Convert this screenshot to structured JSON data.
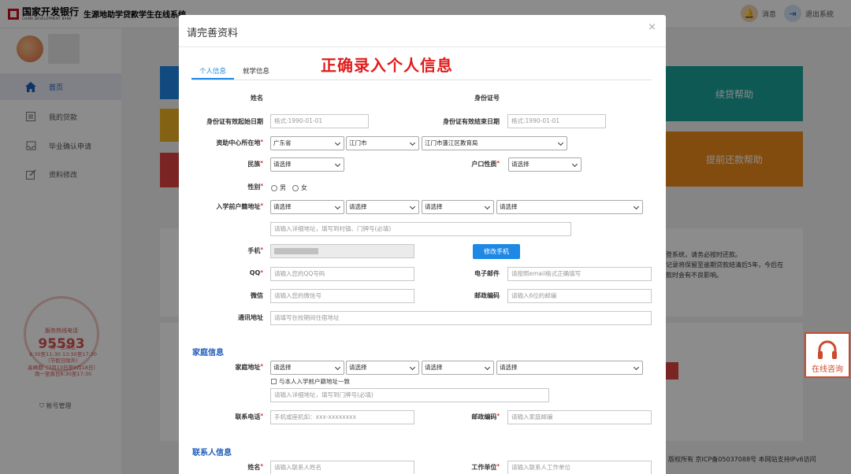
{
  "header": {
    "bank_name": "国家开发银行",
    "bank_name_en": "CHINA DEVELOPMENT BANK",
    "system_name": "生源地助学贷款学生在线系统",
    "messages_label": "消息",
    "logout_label": "退出系统"
  },
  "sidebar": {
    "items": [
      {
        "label": "首页",
        "icon": "home-icon",
        "active": true
      },
      {
        "label": "我的贷款",
        "icon": "list-icon"
      },
      {
        "label": "毕业确认申请",
        "icon": "inbox-icon"
      },
      {
        "label": "资料修改",
        "icon": "edit-icon"
      }
    ],
    "hotline": {
      "label": "服务热线电话",
      "number": "95593",
      "hours": [
        "周一至周五",
        "8:30至11:30 13:30至17:30",
        "（节假日除外）",
        "高峰期（7月13日至9月18日）",
        "周一至周日8:30至17:30"
      ]
    },
    "account_label": "帐号管理"
  },
  "background": {
    "tile_renew": "续贷帮助",
    "tile_prepay": "提前还款帮助",
    "notice_lines": [
      "登系统，请务必按时还款。",
      "记录将保留至逾期贷款结清后5年，今后在",
      "款时会有不良影响。"
    ],
    "footer": "版权所有 京ICP备05037088号 本网站支持IPv6访问",
    "consult_label": "在线咨询"
  },
  "modal": {
    "title": "请完善资料",
    "close": "×",
    "tabs": [
      "个人信息",
      "就学信息"
    ],
    "annotation": "正确录入个人信息",
    "fields": {
      "name_label": "姓名",
      "id_label": "身份证号",
      "id_start_label": "身份证有效起始日期",
      "id_start_placeholder": "格式:1990-01-01",
      "id_end_label": "身份证有效结束日期",
      "id_end_placeholder": "格式:1990-01-01",
      "center_label": "资助中心所在地",
      "center_province": "广东省",
      "center_city": "江门市",
      "center_bureau": "江门市蓬江区教育局",
      "ethnicity_label": "民族",
      "ethnicity_value": "请选择",
      "hukou_type_label": "户口性质",
      "hukou_type_value": "请选择",
      "gender_label": "性别",
      "gender_male": "男",
      "gender_female": "女",
      "hukou_addr_label": "入学前户籍地址",
      "select_placeholder": "请选择",
      "hukou_detail_placeholder": "请输入详细地址，填写到村镇、门牌号(必填)",
      "phone_label": "手机",
      "change_phone": "修改手机",
      "qq_label": "QQ",
      "qq_placeholder": "请输入您的QQ号码",
      "email_label": "电子邮件",
      "email_placeholder": "请按照email格式正确填写",
      "wechat_label": "微信",
      "wechat_placeholder": "请输入您的微信号",
      "postcode_label": "邮政编码",
      "postcode_placeholder": "请输入6位的邮编",
      "mail_addr_label": "通讯地址",
      "mail_addr_placeholder": "请填写在校期间住宿地址"
    },
    "family": {
      "section_title": "家庭信息",
      "addr_label": "家庭地址",
      "same_as_hukou": "与本人入学前户籍地址一致",
      "detail_placeholder": "请输入详细地址，填写到门牌号(必填)",
      "phone_label": "联系电话",
      "phone_placeholder": "手机或座机如：xxx-xxxxxxxx",
      "postcode_label": "邮政编码",
      "postcode_placeholder": "请输入家庭邮编"
    },
    "contact": {
      "section_title": "联系人信息",
      "name_label": "姓名",
      "name_placeholder": "请输入联系人姓名",
      "work_label": "工作单位",
      "work_placeholder": "请输入联系人工作单位"
    }
  },
  "colors": {
    "primary_blue": "#1e88e5",
    "annotation_red": "#e11c1c",
    "tile_teal": "#1aa39a",
    "tile_orange": "#ef8a1c",
    "consult_red": "#cc4b2c"
  }
}
